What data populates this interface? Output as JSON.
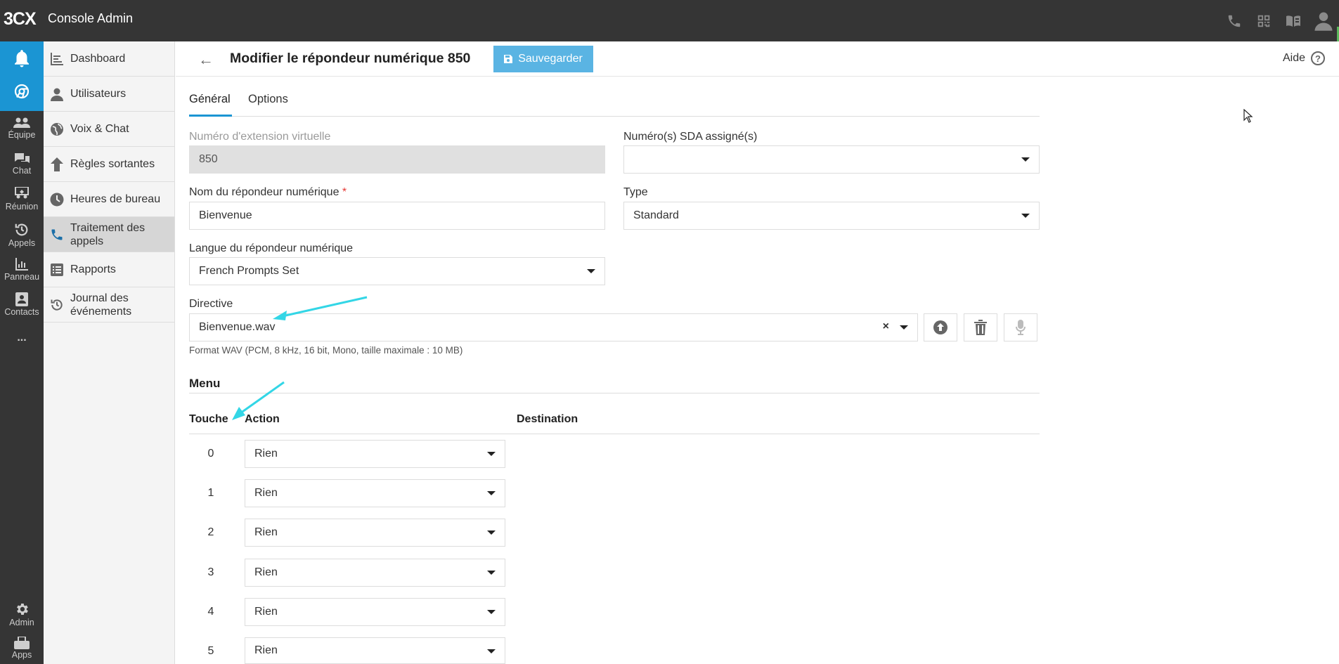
{
  "topbar": {
    "logo": "3CX",
    "title": "Console Admin"
  },
  "rail": [
    {
      "icon": "bell-icon",
      "label": ""
    },
    {
      "icon": "chrome-icon",
      "label": ""
    },
    {
      "icon": "team-icon",
      "label": "Équipe"
    },
    {
      "icon": "chat-icon",
      "label": "Chat"
    },
    {
      "icon": "meeting-icon",
      "label": "Réunion"
    },
    {
      "icon": "history-icon",
      "label": "Appels"
    },
    {
      "icon": "panel-icon",
      "label": "Panneau"
    },
    {
      "icon": "contacts-icon",
      "label": "Contacts"
    },
    {
      "icon": "more-icon",
      "label": "..."
    },
    {
      "icon": "gear-icon",
      "label": "Admin"
    },
    {
      "icon": "apps-icon",
      "label": "Apps"
    }
  ],
  "nav": [
    {
      "label": "Dashboard"
    },
    {
      "label": "Utilisateurs"
    },
    {
      "label": "Voix & Chat"
    },
    {
      "label": "Règles sortantes"
    },
    {
      "label": "Heures de bureau"
    },
    {
      "label": "Traitement des appels"
    },
    {
      "label": "Rapports"
    },
    {
      "label": "Journal des événements"
    }
  ],
  "header": {
    "title": "Modifier le répondeur numérique 850",
    "save_label": "Sauvegarder",
    "help_label": "Aide"
  },
  "tabs": [
    {
      "label": "Général"
    },
    {
      "label": "Options"
    }
  ],
  "form": {
    "ext_label": "Numéro d'extension virtuelle",
    "ext_value": "850",
    "sda_label": "Numéro(s) SDA assigné(s)",
    "sda_value": "",
    "name_label": "Nom du répondeur numérique",
    "name_required": "*",
    "name_value": "Bienvenue",
    "type_label": "Type",
    "type_value": "Standard",
    "lang_label": "Langue du répondeur numérique",
    "lang_value": "French Prompts Set",
    "directive_label": "Directive",
    "directive_value": "Bienvenue.wav",
    "directive_clear": "×",
    "hint": "Format WAV (PCM, 8 kHz, 16 bit, Mono, taille maximale : 10 MB)"
  },
  "menu": {
    "title": "Menu",
    "col_key": "Touche",
    "col_action": "Action",
    "col_destination": "Destination",
    "rows": [
      {
        "key": "0",
        "action": "Rien"
      },
      {
        "key": "1",
        "action": "Rien"
      },
      {
        "key": "2",
        "action": "Rien"
      },
      {
        "key": "3",
        "action": "Rien"
      },
      {
        "key": "4",
        "action": "Rien"
      },
      {
        "key": "5",
        "action": "Rien"
      }
    ]
  },
  "colors": {
    "topbar": "#353535",
    "accent": "#1b95d3",
    "save": "#5ab4e3",
    "annotation_arrow": "#33d6e6"
  }
}
